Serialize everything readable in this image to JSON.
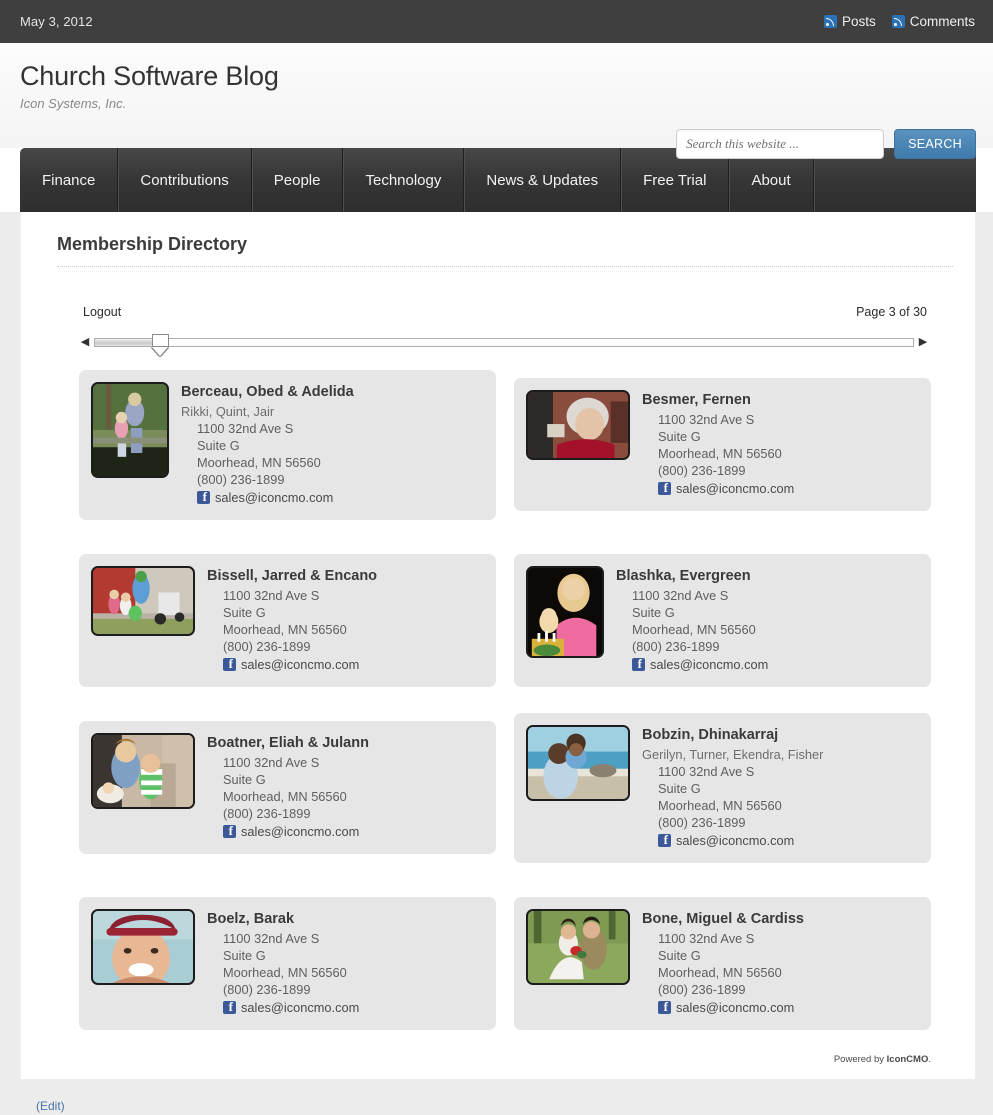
{
  "topbar": {
    "date": "May 3, 2012",
    "feeds": [
      {
        "label": "Posts",
        "icon": "rss-icon"
      },
      {
        "label": "Comments",
        "icon": "rss-icon"
      }
    ]
  },
  "header": {
    "site_title": "Church Software Blog",
    "tagline": "Icon Systems, Inc.",
    "search": {
      "placeholder": "Search this website ...",
      "value": "",
      "button_label": "SEARCH"
    }
  },
  "nav": {
    "items": [
      {
        "label": "Finance"
      },
      {
        "label": "Contributions"
      },
      {
        "label": "People"
      },
      {
        "label": "Technology"
      },
      {
        "label": "News & Updates"
      },
      {
        "label": "Free Trial"
      },
      {
        "label": "About"
      }
    ]
  },
  "page": {
    "title": "Membership Directory",
    "logout_label": "Logout",
    "page_indicator": "Page 3 of 30",
    "slider": {
      "prev_arrow": "◀",
      "next_arrow": "▶",
      "position_percent": 8
    },
    "powered_by_prefix": "Powered by ",
    "powered_by_name": "IconCMO",
    "powered_by_suffix": ".",
    "edit_label": "(Edit)"
  },
  "members": [
    {
      "name": "Berceau, Obed & Adelida",
      "children": "Rikki, Quint, Jair",
      "address1": "1100 32nd Ave S",
      "address2": "Suite G",
      "city_state_zip": "Moorhead, MN 56560",
      "phone": "(800) 236-1899",
      "email": "sales@iconcmo.com",
      "photo_alt": "woman and child sitting on bench outdoors"
    },
    {
      "name": "Besmer, Fernen",
      "children": "",
      "address1": "1100 32nd Ave S",
      "address2": "Suite G",
      "city_state_zip": "Moorhead, MN 56560",
      "phone": "(800) 236-1899",
      "email": "sales@iconcmo.com",
      "photo_alt": "elderly woman in red against brick wall"
    },
    {
      "name": "Bissell, Jarred & Encano",
      "children": "",
      "address1": "1100 32nd Ave S",
      "address2": "Suite G",
      "city_state_zip": "Moorhead, MN 56560",
      "phone": "(800) 236-1899",
      "email": "sales@iconcmo.com",
      "photo_alt": "family with children and stroller by red building"
    },
    {
      "name": "Blashka, Evergreen",
      "children": "",
      "address1": "1100 32nd Ave S",
      "address2": "Suite G",
      "city_state_zip": "Moorhead, MN 56560",
      "phone": "(800) 236-1899",
      "email": "sales@iconcmo.com",
      "photo_alt": "woman in pink with young girl and birthday cake"
    },
    {
      "name": "Boatner, Eliah & Julann",
      "children": "",
      "address1": "1100 32nd Ave S",
      "address2": "Suite G",
      "city_state_zip": "Moorhead, MN 56560",
      "phone": "(800) 236-1899",
      "email": "sales@iconcmo.com",
      "photo_alt": "woman with two children on couch"
    },
    {
      "name": "Bobzin, Dhinakarraj",
      "children": "Gerilyn, Turner, Ekendra, Fisher",
      "address1": "1100 32nd Ave S",
      "address2": "Suite G",
      "city_state_zip": "Moorhead, MN 56560",
      "phone": "(800) 236-1899",
      "email": "sales@iconcmo.com",
      "photo_alt": "man holding child at the beach"
    },
    {
      "name": "Boelz, Barak",
      "children": "",
      "address1": "1100 32nd Ave S",
      "address2": "Suite G",
      "city_state_zip": "Moorhead, MN 56560",
      "phone": "(800) 236-1899",
      "email": "sales@iconcmo.com",
      "photo_alt": "smiling man in red cap"
    },
    {
      "name": "Bone, Miguel & Cardiss",
      "children": "",
      "address1": "1100 32nd Ave S",
      "address2": "Suite G",
      "city_state_zip": "Moorhead, MN 56560",
      "phone": "(800) 236-1899",
      "email": "sales@iconcmo.com",
      "photo_alt": "bride and groom seated on grass"
    }
  ]
}
